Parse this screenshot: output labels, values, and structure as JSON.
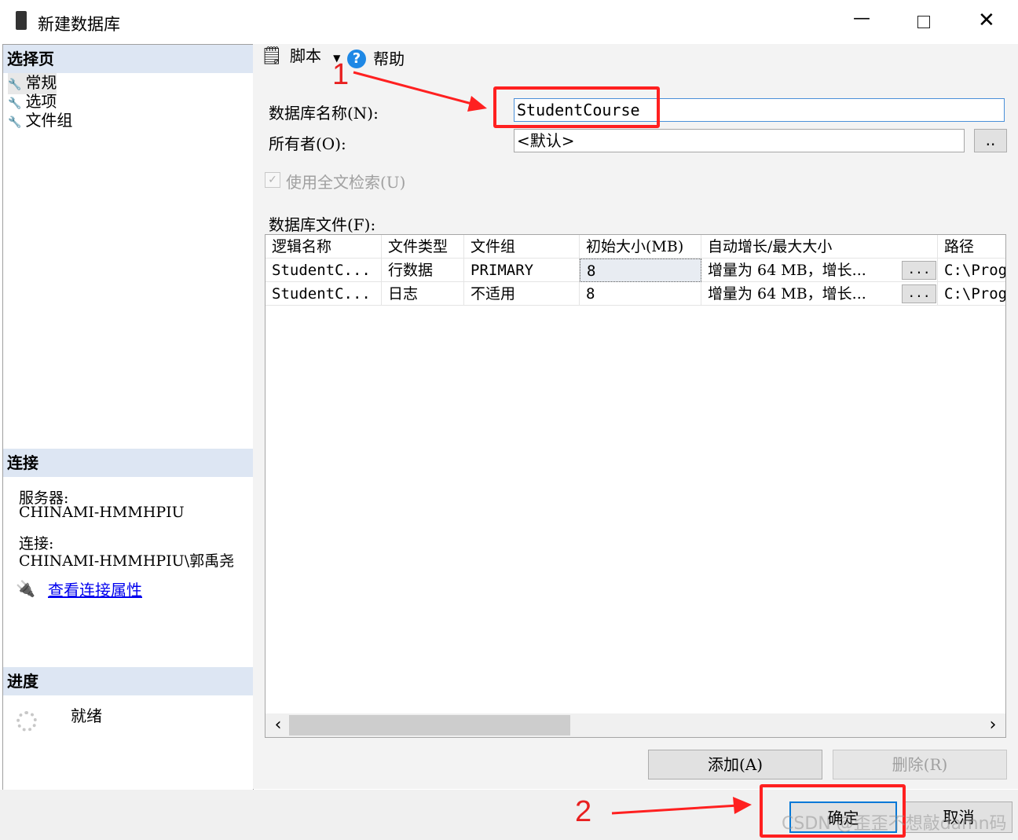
{
  "window": {
    "title": "新建数据库",
    "minimize": "—",
    "close": "✕"
  },
  "left": {
    "select_page_header": "选择页",
    "pages": [
      "常规",
      "选项",
      "文件组"
    ],
    "connection_header": "连接",
    "server_label": "服务器:",
    "server_value": "CHINAMI-HMMHPIU",
    "connection_label": "连接:",
    "connection_value": "CHINAMI-HMMHPIU\\郭禹尧",
    "view_props_link": "查看连接属性",
    "progress_header": "进度",
    "progress_status": "就绪"
  },
  "toolbar": {
    "script_label": "脚本",
    "help_label": "帮助"
  },
  "form": {
    "db_name_label": "数据库名称(N):",
    "db_name_value": "StudentCourse",
    "owner_label": "所有者(O):",
    "owner_value": "<默认>",
    "owner_browse": "..",
    "fulltext_label": "使用全文检索(U)",
    "files_label": "数据库文件(F):"
  },
  "grid": {
    "columns": [
      "逻辑名称",
      "文件类型",
      "文件组",
      "初始大小(MB)",
      "自动增长/最大大小",
      "路径"
    ],
    "rows": [
      [
        "StudentC...",
        "行数据",
        "PRIMARY",
        "8",
        "增量为 64 MB，增长...",
        "C:\\Prog"
      ],
      [
        "StudentC...",
        "日志",
        "不适用",
        "8",
        "增量为 64 MB，增长...",
        "C:\\Prog"
      ]
    ],
    "ellipsis": "...",
    "scroll_left": "‹",
    "scroll_right": "›"
  },
  "buttons": {
    "add": "添加(A)",
    "remove": "删除(R)",
    "ok": "确定",
    "cancel": "取消"
  },
  "annotations": {
    "one": "1",
    "two": "2",
    "watermark": "CSDN @歪歪不想敲damn码"
  },
  "colors": {
    "annotation_red": "#ff2020",
    "header_bg": "#dde6f3",
    "link": "#0000ee"
  }
}
